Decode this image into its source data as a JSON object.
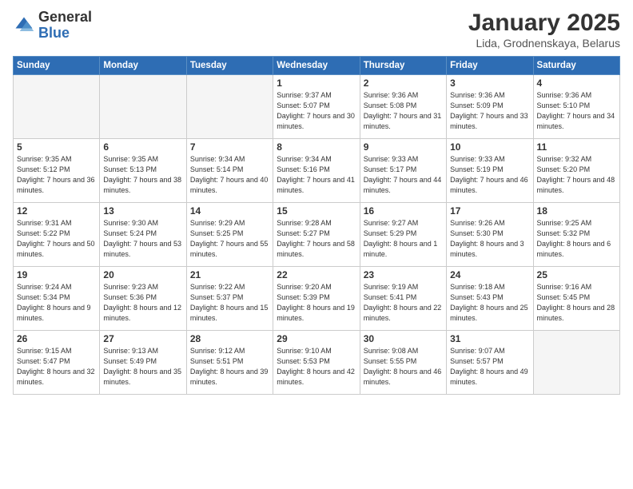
{
  "header": {
    "logo_general": "General",
    "logo_blue": "Blue",
    "month_title": "January 2025",
    "subtitle": "Lida, Grodnenskaya, Belarus"
  },
  "weekdays": [
    "Sunday",
    "Monday",
    "Tuesday",
    "Wednesday",
    "Thursday",
    "Friday",
    "Saturday"
  ],
  "weeks": [
    [
      {
        "day": "",
        "info": ""
      },
      {
        "day": "",
        "info": ""
      },
      {
        "day": "",
        "info": ""
      },
      {
        "day": "1",
        "info": "Sunrise: 9:37 AM\nSunset: 5:07 PM\nDaylight: 7 hours\nand 30 minutes."
      },
      {
        "day": "2",
        "info": "Sunrise: 9:36 AM\nSunset: 5:08 PM\nDaylight: 7 hours\nand 31 minutes."
      },
      {
        "day": "3",
        "info": "Sunrise: 9:36 AM\nSunset: 5:09 PM\nDaylight: 7 hours\nand 33 minutes."
      },
      {
        "day": "4",
        "info": "Sunrise: 9:36 AM\nSunset: 5:10 PM\nDaylight: 7 hours\nand 34 minutes."
      }
    ],
    [
      {
        "day": "5",
        "info": "Sunrise: 9:35 AM\nSunset: 5:12 PM\nDaylight: 7 hours\nand 36 minutes."
      },
      {
        "day": "6",
        "info": "Sunrise: 9:35 AM\nSunset: 5:13 PM\nDaylight: 7 hours\nand 38 minutes."
      },
      {
        "day": "7",
        "info": "Sunrise: 9:34 AM\nSunset: 5:14 PM\nDaylight: 7 hours\nand 40 minutes."
      },
      {
        "day": "8",
        "info": "Sunrise: 9:34 AM\nSunset: 5:16 PM\nDaylight: 7 hours\nand 41 minutes."
      },
      {
        "day": "9",
        "info": "Sunrise: 9:33 AM\nSunset: 5:17 PM\nDaylight: 7 hours\nand 44 minutes."
      },
      {
        "day": "10",
        "info": "Sunrise: 9:33 AM\nSunset: 5:19 PM\nDaylight: 7 hours\nand 46 minutes."
      },
      {
        "day": "11",
        "info": "Sunrise: 9:32 AM\nSunset: 5:20 PM\nDaylight: 7 hours\nand 48 minutes."
      }
    ],
    [
      {
        "day": "12",
        "info": "Sunrise: 9:31 AM\nSunset: 5:22 PM\nDaylight: 7 hours\nand 50 minutes."
      },
      {
        "day": "13",
        "info": "Sunrise: 9:30 AM\nSunset: 5:24 PM\nDaylight: 7 hours\nand 53 minutes."
      },
      {
        "day": "14",
        "info": "Sunrise: 9:29 AM\nSunset: 5:25 PM\nDaylight: 7 hours\nand 55 minutes."
      },
      {
        "day": "15",
        "info": "Sunrise: 9:28 AM\nSunset: 5:27 PM\nDaylight: 7 hours\nand 58 minutes."
      },
      {
        "day": "16",
        "info": "Sunrise: 9:27 AM\nSunset: 5:29 PM\nDaylight: 8 hours\nand 1 minute."
      },
      {
        "day": "17",
        "info": "Sunrise: 9:26 AM\nSunset: 5:30 PM\nDaylight: 8 hours\nand 3 minutes."
      },
      {
        "day": "18",
        "info": "Sunrise: 9:25 AM\nSunset: 5:32 PM\nDaylight: 8 hours\nand 6 minutes."
      }
    ],
    [
      {
        "day": "19",
        "info": "Sunrise: 9:24 AM\nSunset: 5:34 PM\nDaylight: 8 hours\nand 9 minutes."
      },
      {
        "day": "20",
        "info": "Sunrise: 9:23 AM\nSunset: 5:36 PM\nDaylight: 8 hours\nand 12 minutes."
      },
      {
        "day": "21",
        "info": "Sunrise: 9:22 AM\nSunset: 5:37 PM\nDaylight: 8 hours\nand 15 minutes."
      },
      {
        "day": "22",
        "info": "Sunrise: 9:20 AM\nSunset: 5:39 PM\nDaylight: 8 hours\nand 19 minutes."
      },
      {
        "day": "23",
        "info": "Sunrise: 9:19 AM\nSunset: 5:41 PM\nDaylight: 8 hours\nand 22 minutes."
      },
      {
        "day": "24",
        "info": "Sunrise: 9:18 AM\nSunset: 5:43 PM\nDaylight: 8 hours\nand 25 minutes."
      },
      {
        "day": "25",
        "info": "Sunrise: 9:16 AM\nSunset: 5:45 PM\nDaylight: 8 hours\nand 28 minutes."
      }
    ],
    [
      {
        "day": "26",
        "info": "Sunrise: 9:15 AM\nSunset: 5:47 PM\nDaylight: 8 hours\nand 32 minutes."
      },
      {
        "day": "27",
        "info": "Sunrise: 9:13 AM\nSunset: 5:49 PM\nDaylight: 8 hours\nand 35 minutes."
      },
      {
        "day": "28",
        "info": "Sunrise: 9:12 AM\nSunset: 5:51 PM\nDaylight: 8 hours\nand 39 minutes."
      },
      {
        "day": "29",
        "info": "Sunrise: 9:10 AM\nSunset: 5:53 PM\nDaylight: 8 hours\nand 42 minutes."
      },
      {
        "day": "30",
        "info": "Sunrise: 9:08 AM\nSunset: 5:55 PM\nDaylight: 8 hours\nand 46 minutes."
      },
      {
        "day": "31",
        "info": "Sunrise: 9:07 AM\nSunset: 5:57 PM\nDaylight: 8 hours\nand 49 minutes."
      },
      {
        "day": "",
        "info": ""
      }
    ]
  ]
}
